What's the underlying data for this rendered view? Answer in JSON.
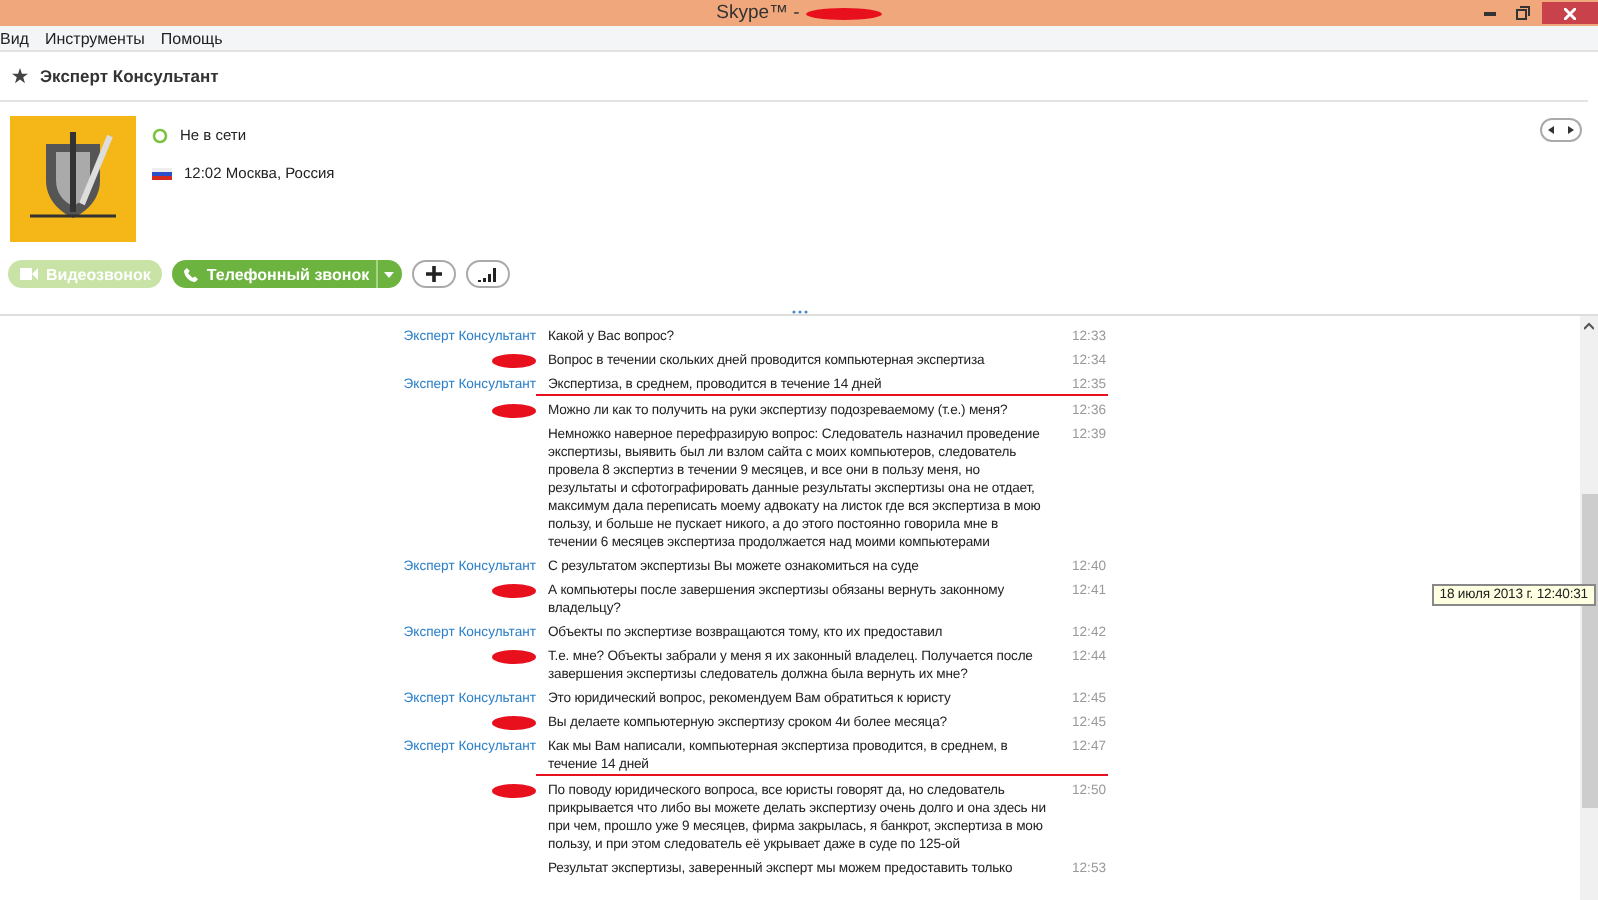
{
  "window": {
    "title": "Skype™ -"
  },
  "menu": [
    "Вид",
    "Инструменты",
    "Помощь"
  ],
  "contact": {
    "name": "Эксперт Консультант",
    "status": "Не в сети",
    "location": "12:02 Москва, Россия"
  },
  "buttons": {
    "video": {
      "label": "Видеозвонок",
      "disabled": true
    },
    "call": {
      "label": "Телефонный звонок",
      "disabled": false
    }
  },
  "messages": [
    {
      "kind": "contact",
      "sender": "Эксперт Консультант",
      "text": "Какой у Вас вопрос?",
      "time": "12:33",
      "underlined": false
    },
    {
      "kind": "self",
      "text": "Вопрос в течении скольких дней проводится компьютерная экспертиза",
      "time": "12:34",
      "underlined": false
    },
    {
      "kind": "contact",
      "sender": "Эксперт Консультант",
      "text": "Экспертиза, в среднем, проводится в течение 14 дней",
      "time": "12:35",
      "underlined": true
    },
    {
      "kind": "self",
      "text": "Можно ли как то получить на руки экспертизу подозреваемому (т.е.) меня?",
      "time": "12:36",
      "underlined": false
    },
    {
      "kind": "continuation",
      "text": "Немножко наверное перефразирую вопрос: Следователь назначил проведение экспертизы, выявить был ли взлом сайта с моих компьютеров, следователь провела 8 экспертиз в течении 9 месяцев, и все они в пользу меня, но результаты и сфотографировать данные результаты экспертизы она не отдает, максимум дала переписать моему адвокату на листок где вся экспертиза в мою пользу, и больше не пускает никого, а до этого постоянно говорила мне в течении 6 месяцев экспертиза продолжается над моими компьютерами",
      "time": "12:39",
      "underlined": false
    },
    {
      "kind": "contact",
      "sender": "Эксперт Консультант",
      "text": "С результатом экспертизы Вы можете ознакомиться на суде",
      "time": "12:40",
      "underlined": false
    },
    {
      "kind": "self",
      "text": "А компьютеры после завершения экспертизы обязаны вернуть законному владельцу?",
      "time": "12:41",
      "underlined": false
    },
    {
      "kind": "contact",
      "sender": "Эксперт Консультант",
      "text": "Объекты по экспертизе возвращаются тому, кто их предоставил",
      "time": "12:42",
      "underlined": false
    },
    {
      "kind": "self",
      "text": "Т.е. мне? Объекты забрали у меня я их законный владелец. Получается после завершения экспертизы следователь должна была вернуть их мне?",
      "time": "12:44",
      "underlined": false
    },
    {
      "kind": "contact",
      "sender": "Эксперт Консультант",
      "text": "Это юридический вопрос, рекомендуем Вам обратиться к юристу",
      "time": "12:45",
      "underlined": false
    },
    {
      "kind": "self",
      "text": "Вы делаете компьютерную экспертизу сроком 4и более месяца?",
      "time": "12:45",
      "underlined": false
    },
    {
      "kind": "contact",
      "sender": "Эксперт Консультант",
      "text": "Как  мы Вам написали, компьютерная экспертиза проводится, в среднем, в течение 14 дней",
      "time": "12:47",
      "underlined": true
    },
    {
      "kind": "self",
      "text": "По поводу юридического вопроса, все юристы говорят да, но следователь прикрывается что либо вы можете делать экспертизу очень долго и она здесь ни при чем, прошло уже 9 месяцев, фирма закрылась, я банкрот, экспертиза в мою пользу, и при этом следователь её укрывает даже в суде по 125-ой",
      "time": "12:50",
      "underlined": false
    },
    {
      "kind": "continuation",
      "text": "Результат экспертизы, заверенный эксперт мы можем предоставить только",
      "time": "12:53",
      "underlined": false
    }
  ],
  "tooltip": "18 июля 2013 г. 12:40:31"
}
